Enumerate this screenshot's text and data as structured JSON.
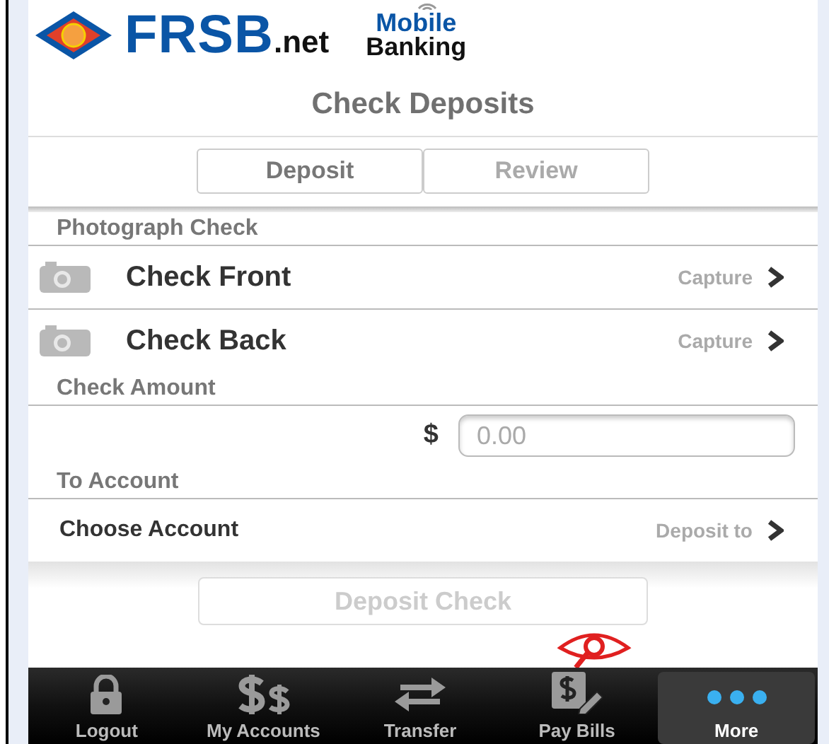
{
  "header": {
    "brand": "FRSB",
    "brand_suffix": ".net",
    "tagline_top": "Mobile",
    "tagline_bottom": "Banking"
  },
  "title": "Check Deposits",
  "segments": [
    {
      "label": "Deposit",
      "selected": true
    },
    {
      "label": "Review",
      "selected": false
    }
  ],
  "sections": [
    {
      "heading": "Photograph Check",
      "rows": [
        {
          "kind": "capture",
          "label": "Check Front",
          "action": "Capture"
        },
        {
          "kind": "capture",
          "label": "Check Back",
          "action": "Capture"
        }
      ]
    },
    {
      "heading": "Check Amount",
      "rows": [
        {
          "kind": "amount",
          "currency": "$",
          "placeholder": "0.00"
        }
      ]
    },
    {
      "heading": "To Account",
      "rows": [
        {
          "kind": "choose",
          "label": "Choose Account",
          "action": "Deposit to"
        }
      ]
    }
  ],
  "submit": {
    "label": "Deposit Check",
    "disabled": true
  },
  "tabbar": [
    {
      "kind": "lock",
      "label": "Logout",
      "selected": false
    },
    {
      "kind": "dollars",
      "label": "My Accounts",
      "selected": false
    },
    {
      "kind": "transfer",
      "label": "Transfer",
      "selected": false
    },
    {
      "kind": "bill",
      "label": "Pay Bills",
      "selected": false
    },
    {
      "kind": "more",
      "label": "More",
      "selected": true
    }
  ]
}
